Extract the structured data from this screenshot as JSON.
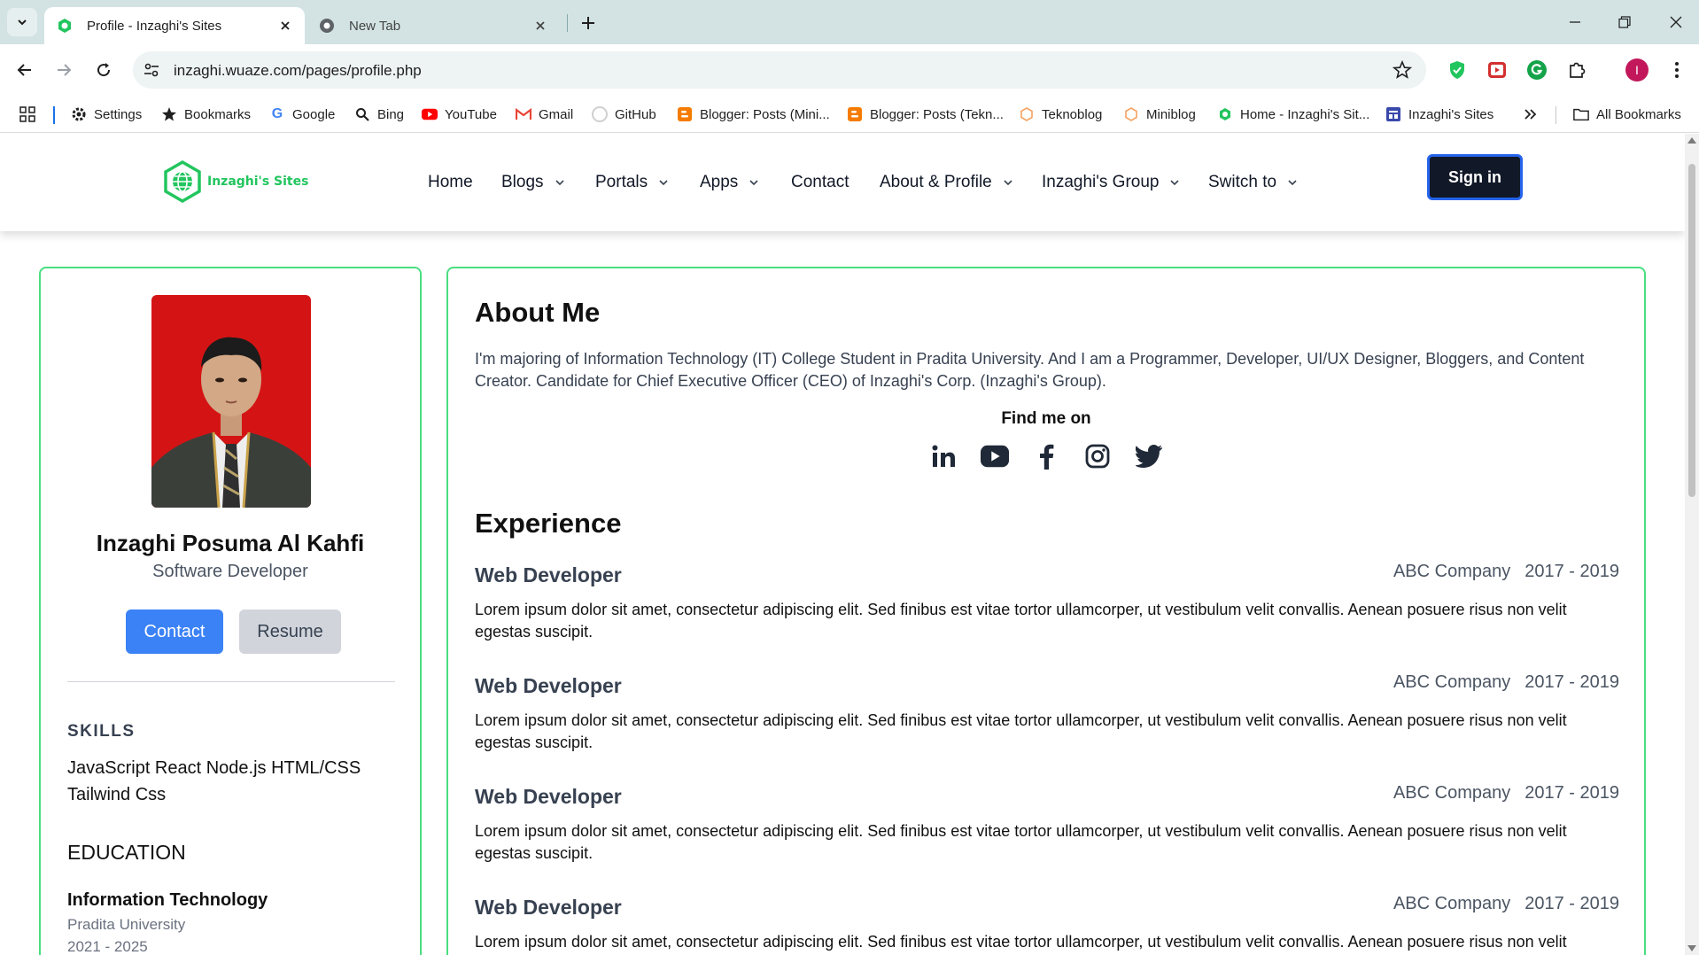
{
  "browser": {
    "tabs": [
      {
        "title": "Profile - Inzaghi's Sites",
        "active": true
      },
      {
        "title": "New Tab",
        "active": false
      }
    ],
    "url": "inzaghi.wuaze.com/pages/profile.php",
    "avatar_letter": "I",
    "bookmarks": [
      {
        "label": "Settings",
        "icon": "gear-icon"
      },
      {
        "label": "Bookmarks",
        "icon": "star-icon"
      },
      {
        "label": "Google",
        "icon": "google-icon"
      },
      {
        "label": "Bing",
        "icon": "search-icon"
      },
      {
        "label": "YouTube",
        "icon": "youtube-icon"
      },
      {
        "label": "Gmail",
        "icon": "gmail-icon"
      },
      {
        "label": "GitHub",
        "icon": "github-icon"
      },
      {
        "label": "Blogger: Posts (Mini...",
        "icon": "blogger-icon"
      },
      {
        "label": "Blogger: Posts (Tekn...",
        "icon": "blogger-icon"
      },
      {
        "label": "Teknoblog",
        "icon": "hexagon-icon"
      },
      {
        "label": "Miniblog",
        "icon": "hexagon-icon"
      },
      {
        "label": "Home - Inzaghi's Sit...",
        "icon": "site-icon"
      },
      {
        "label": "Inzaghi's Sites",
        "icon": "site-icon"
      }
    ],
    "all_bookmarks": "All Bookmarks"
  },
  "site": {
    "logo_text": "Inzaghi's Sites",
    "nav": [
      {
        "label": "Home",
        "dropdown": false
      },
      {
        "label": "Blogs",
        "dropdown": true
      },
      {
        "label": "Portals",
        "dropdown": true
      },
      {
        "label": "Apps",
        "dropdown": true
      },
      {
        "label": "Contact",
        "dropdown": false
      },
      {
        "label": "About & Profile",
        "dropdown": true
      },
      {
        "label": "Inzaghi's Group",
        "dropdown": true
      },
      {
        "label": "Switch to",
        "dropdown": true
      }
    ],
    "signin": "Sign in"
  },
  "profile": {
    "name": "Inzaghi Posuma Al Kahfi",
    "role": "Software Developer",
    "contact_button": "Contact",
    "resume_button": "Resume",
    "skills_title": "SKILLS",
    "skills": "JavaScript React Node.js HTML/CSS Tailwind Css",
    "education_title": "EDUCATION",
    "education": {
      "degree": "Information Technology",
      "school": "Pradita University",
      "years": "2021 - 2025"
    }
  },
  "about": {
    "title": "About Me",
    "text": "I'm majoring of Information Technology (IT) College Student in Pradita University. And I am a Programmer, Developer, UI/UX Designer, Bloggers, and Content Creator. Candidate for Chief Executive Officer (CEO) of Inzaghi's Corp. (Inzaghi's Group).",
    "find_me": "Find me on",
    "socials": [
      "linkedin-icon",
      "youtube-icon",
      "facebook-icon",
      "instagram-icon",
      "twitter-icon"
    ]
  },
  "experience": {
    "title": "Experience",
    "jobs": [
      {
        "title": "Web Developer",
        "company": "ABC Company",
        "period": "2017 - 2019",
        "description": "Lorem ipsum dolor sit amet, consectetur adipiscing elit. Sed finibus est vitae tortor ullamcorper, ut vestibulum velit convallis. Aenean posuere risus non velit egestas suscipit."
      },
      {
        "title": "Web Developer",
        "company": "ABC Company",
        "period": "2017 - 2019",
        "description": "Lorem ipsum dolor sit amet, consectetur adipiscing elit. Sed finibus est vitae tortor ullamcorper, ut vestibulum velit convallis. Aenean posuere risus non velit egestas suscipit."
      },
      {
        "title": "Web Developer",
        "company": "ABC Company",
        "period": "2017 - 2019",
        "description": "Lorem ipsum dolor sit amet, consectetur adipiscing elit. Sed finibus est vitae tortor ullamcorper, ut vestibulum velit convallis. Aenean posuere risus non velit egestas suscipit."
      },
      {
        "title": "Web Developer",
        "company": "ABC Company",
        "period": "2017 - 2019",
        "description": "Lorem ipsum dolor sit amet, consectetur adipiscing elit. Sed finibus est vitae tortor ullamcorper, ut vestibulum velit convallis. Aenean posuere risus non velit egestas suscipit."
      }
    ]
  },
  "colors": {
    "accent_green": "#22c55e",
    "card_border": "#4ade80",
    "contact_blue": "#3b82f6",
    "signin_bg": "#111827"
  }
}
